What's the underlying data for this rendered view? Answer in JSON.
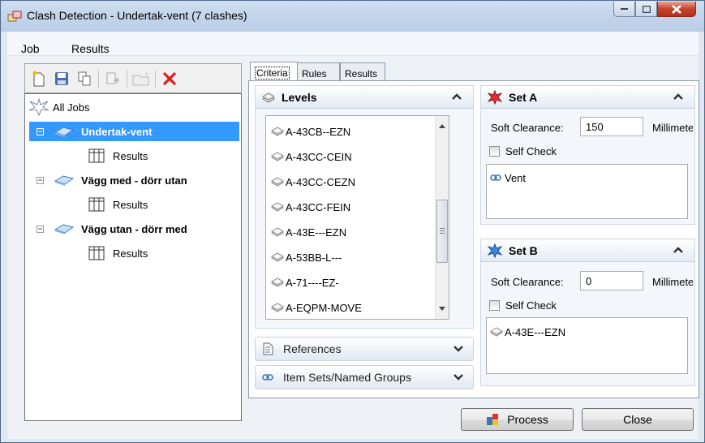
{
  "window": {
    "title": "Clash Detection - Undertak-vent (7 clashes)"
  },
  "menu": {
    "job": "Job",
    "results": "Results"
  },
  "tree": {
    "all_jobs": "All Jobs",
    "jobs": [
      {
        "name": "Undertak-vent",
        "child": "Results",
        "selected": true
      },
      {
        "name": "Vägg med - dörr utan",
        "child": "Results"
      },
      {
        "name": "Vägg utan - dörr med",
        "child": "Results"
      }
    ]
  },
  "tabs": [
    "Criteria",
    "Rules",
    "Results"
  ],
  "levels": {
    "title": "Levels",
    "items": [
      "A-43CB--EZN",
      "A-43CC-CEIN",
      "A-43CC-CEZN",
      "A-43CC-FEIN",
      "A-43E---EZN",
      "A-53BB-L---",
      "A-71----EZ-",
      "A-EQPM-MOVE"
    ]
  },
  "references": {
    "title": "References"
  },
  "item_sets": {
    "title": "Item Sets/Named Groups"
  },
  "set_a": {
    "title": "Set A",
    "soft_clearance_label": "Soft Clearance:",
    "soft_clearance_value": "150",
    "unit": "Millimete",
    "self_check": "Self Check",
    "items": [
      "Vent"
    ]
  },
  "set_b": {
    "title": "Set B",
    "soft_clearance_label": "Soft Clearance:",
    "soft_clearance_value": "0",
    "unit": "Millimete",
    "self_check": "Self Check",
    "items": [
      "A-43E---EZN"
    ]
  },
  "buttons": {
    "process": "Process",
    "close": "Close"
  }
}
